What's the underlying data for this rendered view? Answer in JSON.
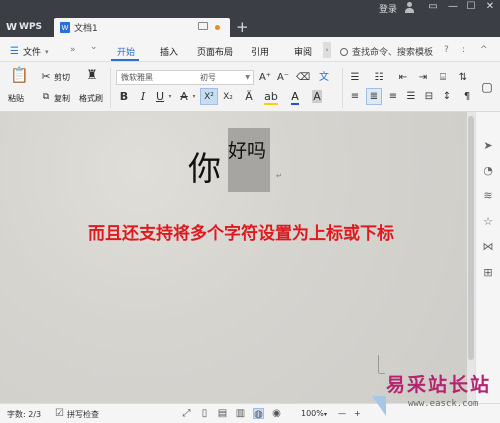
{
  "app": {
    "name": "WPS",
    "tab_title": "文档1",
    "login": "登录",
    "new_tab": "+",
    "win_min": "▭",
    "win_min2": "—",
    "win_max": "☐",
    "win_close": "✕"
  },
  "menu": {
    "file": "文件",
    "more": "»",
    "dropdown": "⌄",
    "tabs": [
      "开始",
      "插入",
      "页面布局",
      "引用",
      "审阅"
    ],
    "active": "开始",
    "search": "查找命令、搜索模板",
    "help": "?",
    "menu_extra": ":",
    "collapse": "^"
  },
  "toolbar": {
    "paste": "粘贴",
    "cut": "剪切",
    "copy": "复制",
    "format_painter": "格式刷",
    "font_name": "微软雅黑",
    "font_size": "初号",
    "bold": "B",
    "italic": "I",
    "underline": "U",
    "strike": "A",
    "superscript": "X²",
    "subscript": "X₂"
  },
  "document": {
    "normal_char": "你",
    "superscript_text": "好吗",
    "caption": "而且还支持将多个字符设置为上标或下标"
  },
  "status": {
    "word_count": "字数: 2/3",
    "spell_check": "拼写检查",
    "zoom": "100%",
    "zoom_out": "—",
    "zoom_in": "+"
  },
  "watermark": {
    "site": "易采站长站",
    "url": "www.easck.com"
  },
  "colors": {
    "accent": "#2a6fd8",
    "caption_red": "#e0191e",
    "titlebar": "#3b3f45",
    "watermark": "#b4246f"
  }
}
